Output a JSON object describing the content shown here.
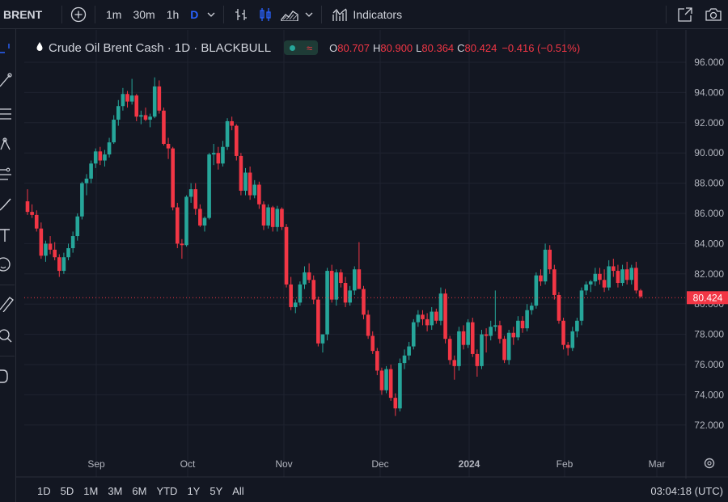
{
  "toolbar": {
    "symbol": "BRENT",
    "intervals": [
      "1m",
      "30m",
      "1h",
      "D"
    ],
    "active_interval": "D",
    "indicators_label": "Indicators"
  },
  "legend": {
    "title": "Crude Oil Brent Cash · 1D · BLACKBULL",
    "o_key": "O",
    "o_val": "80.707",
    "h_key": "H",
    "h_val": "80.900",
    "l_key": "L",
    "l_val": "80.364",
    "c_key": "C",
    "c_val": "80.424",
    "change": "−0.416 (−0.51%)"
  },
  "price_axis": {
    "ticks": [
      "96.000",
      "94.000",
      "92.000",
      "90.000",
      "88.000",
      "86.000",
      "84.000",
      "82.000",
      "80.000",
      "78.000",
      "76.000",
      "74.000",
      "72.000"
    ],
    "last_price": "80.424"
  },
  "time_axis": {
    "labels": [
      "Sep",
      "Oct",
      "Nov",
      "Dec",
      "2024",
      "Feb",
      "Mar"
    ]
  },
  "bottom": {
    "ranges": [
      "1D",
      "5D",
      "1M",
      "3M",
      "6M",
      "YTD",
      "1Y",
      "5Y",
      "All"
    ],
    "clock": "03:04:18 (UTC)"
  },
  "colors": {
    "up": "#26a69a",
    "down": "#f23645",
    "background": "#131722",
    "grid": "#1f2330",
    "active": "#2962ff"
  },
  "chart_data": {
    "type": "candlestick",
    "title": "Crude Oil Brent Cash · 1D · BLACKBULL",
    "ylim": [
      71,
      97
    ],
    "x_labels": [
      "Sep",
      "Oct",
      "Nov",
      "Dec",
      "2024",
      "Feb",
      "Mar"
    ],
    "y_ticks": [
      96,
      94,
      92,
      90,
      88,
      86,
      84,
      82,
      80,
      78,
      76,
      74,
      72
    ],
    "last_price": 80.424,
    "grid": true,
    "candles": [
      [
        86.8,
        87.6,
        85.9,
        86.1
      ],
      [
        86.1,
        86.6,
        85.7,
        85.9
      ],
      [
        85.9,
        86.2,
        84.8,
        85.0
      ],
      [
        85.0,
        85.4,
        83.0,
        83.2
      ],
      [
        83.2,
        84.2,
        82.8,
        84.0
      ],
      [
        84.0,
        84.5,
        83.3,
        83.6
      ],
      [
        83.6,
        84.1,
        82.9,
        83.1
      ],
      [
        83.1,
        83.3,
        81.8,
        82.2
      ],
      [
        82.2,
        83.4,
        82.0,
        83.1
      ],
      [
        83.1,
        84.0,
        82.9,
        83.7
      ],
      [
        83.7,
        84.8,
        83.4,
        84.5
      ],
      [
        84.5,
        86.0,
        84.2,
        85.8
      ],
      [
        85.8,
        88.1,
        85.6,
        88.0
      ],
      [
        88.0,
        88.6,
        87.2,
        88.3
      ],
      [
        88.3,
        89.5,
        88.0,
        89.3
      ],
      [
        89.3,
        90.3,
        89.0,
        90.1
      ],
      [
        90.1,
        90.4,
        89.2,
        89.5
      ],
      [
        89.5,
        90.2,
        89.1,
        89.9
      ],
      [
        89.9,
        91.0,
        89.7,
        90.7
      ],
      [
        90.7,
        92.5,
        90.6,
        92.2
      ],
      [
        92.2,
        93.5,
        91.8,
        93.1
      ],
      [
        93.1,
        94.3,
        92.8,
        93.9
      ],
      [
        93.9,
        94.1,
        93.0,
        93.4
      ],
      [
        93.4,
        94.9,
        93.2,
        93.8
      ],
      [
        93.8,
        93.9,
        92.1,
        92.4
      ],
      [
        92.4,
        92.8,
        91.9,
        92.5
      ],
      [
        92.5,
        93.0,
        92.1,
        92.2
      ],
      [
        92.2,
        92.6,
        91.7,
        92.4
      ],
      [
        92.4,
        95.0,
        92.3,
        94.4
      ],
      [
        94.4,
        94.8,
        92.6,
        92.8
      ],
      [
        92.8,
        93.0,
        90.5,
        90.6
      ],
      [
        90.6,
        91.0,
        89.6,
        90.3
      ],
      [
        90.3,
        90.4,
        86.2,
        86.4
      ],
      [
        86.4,
        86.7,
        83.7,
        84.0
      ],
      [
        84.0,
        84.3,
        83.0,
        83.9
      ],
      [
        83.9,
        87.2,
        83.8,
        87.1
      ],
      [
        87.1,
        88.0,
        86.7,
        87.6
      ],
      [
        87.6,
        88.0,
        85.9,
        86.3
      ],
      [
        86.3,
        86.6,
        85.1,
        85.2
      ],
      [
        85.2,
        85.8,
        84.8,
        85.7
      ],
      [
        85.7,
        90.0,
        85.6,
        89.9
      ],
      [
        89.9,
        90.6,
        89.2,
        90.0
      ],
      [
        90.0,
        90.4,
        88.9,
        89.3
      ],
      [
        89.3,
        90.8,
        89.1,
        90.4
      ],
      [
        90.4,
        92.3,
        90.2,
        92.1
      ],
      [
        92.1,
        92.4,
        91.5,
        91.8
      ],
      [
        91.8,
        91.9,
        89.5,
        89.8
      ],
      [
        89.8,
        90.0,
        87.2,
        87.5
      ],
      [
        87.5,
        89.0,
        87.2,
        88.7
      ],
      [
        88.7,
        89.1,
        86.9,
        87.2
      ],
      [
        87.2,
        88.2,
        87.0,
        87.9
      ],
      [
        87.9,
        88.1,
        86.3,
        86.6
      ],
      [
        86.6,
        86.8,
        84.9,
        85.2
      ],
      [
        85.2,
        86.6,
        85.0,
        86.4
      ],
      [
        86.4,
        86.5,
        84.8,
        85.1
      ],
      [
        85.1,
        86.5,
        84.8,
        86.3
      ],
      [
        86.3,
        86.4,
        84.9,
        85.1
      ],
      [
        85.1,
        85.3,
        81.1,
        81.3
      ],
      [
        81.3,
        81.8,
        79.6,
        79.8
      ],
      [
        79.8,
        80.3,
        79.4,
        80.1
      ],
      [
        80.1,
        81.5,
        79.9,
        81.3
      ],
      [
        81.3,
        82.5,
        81.0,
        82.1
      ],
      [
        82.1,
        82.7,
        81.4,
        81.6
      ],
      [
        81.6,
        81.9,
        80.0,
        80.3
      ],
      [
        80.3,
        80.5,
        77.2,
        77.4
      ],
      [
        77.4,
        78.0,
        76.8,
        78.0
      ],
      [
        78.0,
        82.4,
        77.6,
        82.2
      ],
      [
        82.2,
        82.6,
        80.1,
        80.3
      ],
      [
        80.3,
        82.3,
        79.9,
        82.1
      ],
      [
        82.1,
        82.3,
        81.1,
        81.4
      ],
      [
        81.4,
        81.8,
        79.8,
        80.1
      ],
      [
        80.1,
        81.2,
        79.9,
        80.9
      ],
      [
        80.9,
        82.5,
        80.6,
        82.3
      ],
      [
        82.3,
        84.1,
        81.9,
        81.0
      ],
      [
        81.0,
        81.2,
        79.0,
        79.3
      ],
      [
        79.3,
        79.6,
        77.7,
        77.9
      ],
      [
        77.9,
        78.2,
        76.7,
        76.9
      ],
      [
        76.9,
        77.1,
        75.3,
        75.6
      ],
      [
        75.6,
        75.8,
        74.0,
        74.3
      ],
      [
        74.3,
        75.9,
        74.1,
        75.7
      ],
      [
        75.7,
        76.0,
        73.6,
        73.8
      ],
      [
        73.8,
        74.1,
        72.6,
        73.1
      ],
      [
        73.1,
        76.4,
        72.9,
        76.1
      ],
      [
        76.1,
        77.0,
        75.7,
        76.6
      ],
      [
        76.6,
        77.5,
        76.3,
        77.2
      ],
      [
        77.2,
        79.0,
        77.0,
        78.8
      ],
      [
        78.8,
        79.6,
        78.5,
        79.3
      ],
      [
        79.3,
        79.6,
        78.6,
        79.0
      ],
      [
        79.0,
        79.4,
        78.2,
        78.6
      ],
      [
        78.6,
        79.8,
        78.3,
        79.5
      ],
      [
        79.5,
        79.7,
        78.7,
        78.9
      ],
      [
        78.9,
        81.1,
        78.6,
        80.7
      ],
      [
        80.7,
        81.0,
        77.4,
        77.7
      ],
      [
        77.7,
        77.9,
        76.0,
        76.3
      ],
      [
        76.3,
        76.6,
        75.0,
        75.9
      ],
      [
        75.9,
        78.5,
        75.6,
        78.2
      ],
      [
        78.2,
        78.6,
        77.0,
        77.3
      ],
      [
        77.3,
        79.0,
        77.1,
        78.8
      ],
      [
        78.8,
        79.1,
        76.5,
        76.7
      ],
      [
        76.7,
        77.0,
        75.2,
        75.9
      ],
      [
        75.9,
        78.3,
        75.7,
        78.0
      ],
      [
        78.0,
        78.4,
        76.8,
        77.9
      ],
      [
        77.9,
        78.9,
        77.6,
        78.5
      ],
      [
        78.5,
        80.9,
        78.2,
        78.6
      ],
      [
        78.6,
        78.9,
        77.4,
        77.7
      ],
      [
        77.7,
        77.9,
        76.1,
        76.3
      ],
      [
        76.3,
        78.3,
        76.0,
        78.1
      ],
      [
        78.1,
        78.5,
        77.3,
        77.8
      ],
      [
        77.8,
        79.2,
        77.6,
        78.9
      ],
      [
        78.9,
        79.2,
        78.1,
        78.4
      ],
      [
        78.4,
        80.0,
        78.2,
        79.6
      ],
      [
        79.6,
        80.1,
        79.3,
        79.9
      ],
      [
        79.9,
        82.1,
        79.7,
        81.9
      ],
      [
        81.9,
        82.3,
        81.2,
        81.5
      ],
      [
        81.5,
        84.0,
        81.3,
        83.6
      ],
      [
        83.6,
        83.9,
        82.0,
        82.3
      ],
      [
        82.3,
        82.6,
        80.3,
        80.6
      ],
      [
        80.6,
        80.8,
        78.7,
        78.9
      ],
      [
        78.9,
        79.1,
        77.0,
        77.3
      ],
      [
        77.3,
        77.5,
        76.6,
        77.1
      ],
      [
        77.1,
        78.5,
        76.9,
        78.2
      ],
      [
        78.2,
        79.1,
        77.8,
        78.9
      ],
      [
        78.9,
        81.1,
        78.6,
        80.9
      ],
      [
        80.9,
        81.5,
        80.6,
        81.3
      ],
      [
        81.3,
        81.6,
        80.8,
        81.5
      ],
      [
        81.5,
        82.4,
        81.2,
        82.0
      ],
      [
        82.0,
        82.4,
        81.3,
        81.6
      ],
      [
        81.6,
        82.3,
        80.8,
        81.1
      ],
      [
        81.1,
        82.9,
        80.9,
        82.5
      ],
      [
        82.5,
        83.0,
        81.8,
        82.2
      ],
      [
        82.2,
        82.6,
        81.1,
        81.4
      ],
      [
        81.4,
        82.6,
        81.2,
        82.3
      ],
      [
        82.3,
        82.8,
        81.3,
        81.6
      ],
      [
        81.6,
        82.6,
        81.3,
        82.4
      ],
      [
        82.4,
        82.8,
        80.7,
        80.9
      ],
      [
        80.9,
        81.0,
        80.4,
        80.5
      ]
    ]
  }
}
